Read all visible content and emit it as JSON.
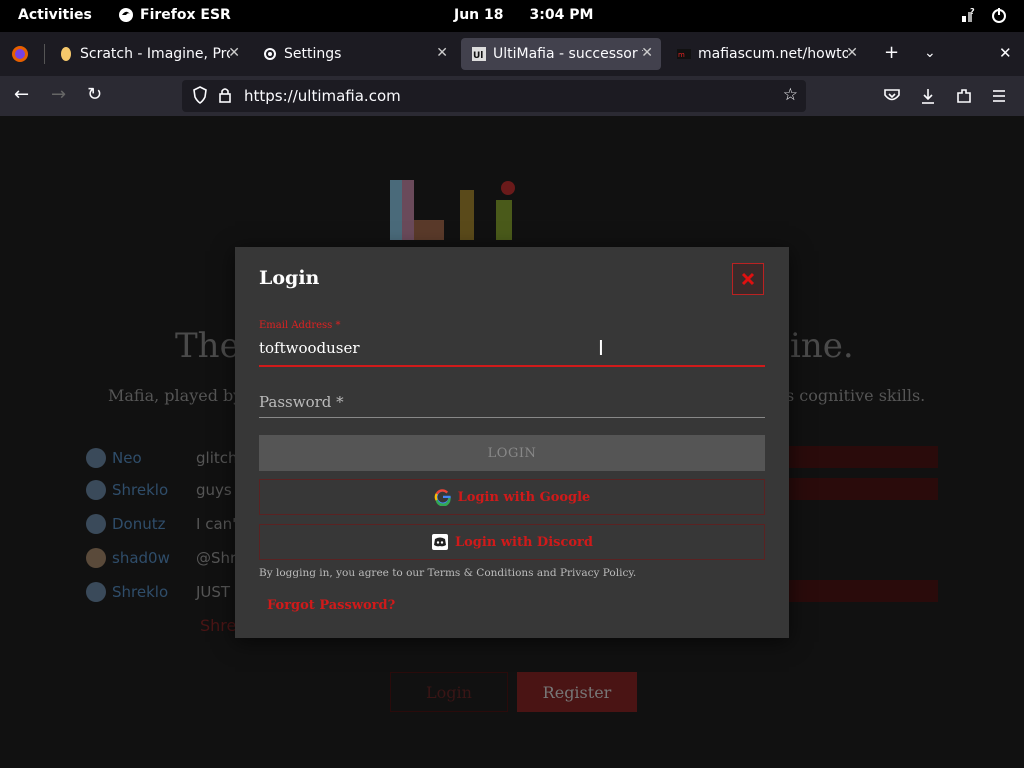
{
  "topbar": {
    "activities": "Activities",
    "app_name": "Firefox ESR",
    "date": "Jun 18",
    "time": "3:04 PM"
  },
  "tabs": [
    {
      "label": "Scratch - Imagine, Prog"
    },
    {
      "label": "Settings"
    },
    {
      "label": "UltiMafia - successor to"
    },
    {
      "label": "mafiascum.net/howtoj"
    }
  ],
  "navbar": {
    "url": "https://ultimafia.com"
  },
  "page": {
    "hero_title_left": "The",
    "hero_title_right": "ine.",
    "hero_sub_left": "Mafia, played by",
    "hero_sub_right": "s cognitive skills.",
    "chat": [
      {
        "name": "Neo",
        "msg": "glitch in"
      },
      {
        "name": "Shreklo",
        "msg": "guys it w"
      },
      {
        "name": "Donutz",
        "msg": "I can't b"
      },
      {
        "name": "shad0w",
        "msg": "@Shrek"
      },
      {
        "name": "Shreklo",
        "msg": "JUST A P"
      }
    ],
    "typing": "Shre",
    "login_bg": "Login",
    "register_bg": "Register"
  },
  "modal": {
    "title": "Login",
    "email_label": "Email Address *",
    "email_value": "toftwooduser",
    "password_placeholder": "Password *",
    "submit": "LOGIN",
    "google": "Login with Google",
    "discord": "Login with Discord",
    "terms": "By logging in, you agree to our Terms & Conditions and Privacy Policy.",
    "forgot": "Forgot Password?"
  },
  "colors": {
    "accent": "#d01a1a",
    "modal_bg": "#373737",
    "page_bg": "#111111"
  }
}
